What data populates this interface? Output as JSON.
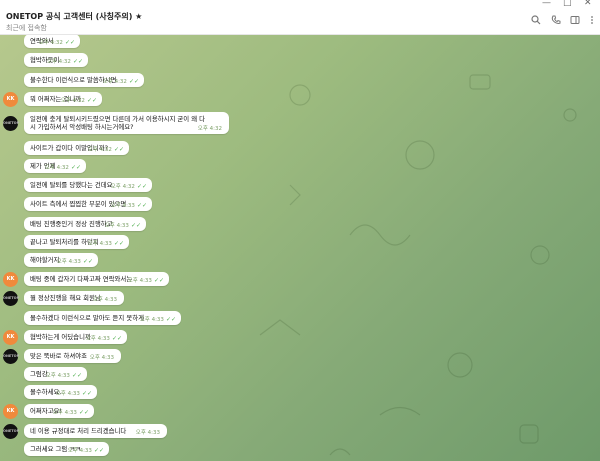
{
  "window": {
    "controls": [
      "—",
      "□",
      "✕"
    ]
  },
  "header": {
    "title": "ONETOP 공식 고객센터 (사칭주의) ★",
    "subtitle": "최근에 접속함",
    "icons": [
      "search-icon",
      "phone-icon",
      "sidebar-icon",
      "more-icon"
    ]
  },
  "messages": [
    {
      "text": "연락와서",
      "time": "오후 4:32",
      "read": "✓✓"
    },
    {
      "text": "협박하듯이",
      "time": "오후 4:32",
      "read": "✓✓"
    },
    {
      "text": "불수한다 이런식으로 말씀하시면",
      "time": "오후 4:32",
      "read": "✓✓"
    },
    {
      "text": "뭐 어쩌자는 겁니까",
      "time": "오후 4:32",
      "read": "✓✓",
      "avatar": "KK"
    },
    {
      "text": "일전에 충게 탈퇴시키드렸으면 다른데 가서 이용하시지 굳이 왜 다시 가입하셔서 악성배팅 하시는거에요?",
      "time": "오후 4:32",
      "read": "",
      "avatar": "ONETOP"
    },
    {
      "text": "사이트가 갑이다 이말입니까?",
      "time": "오후 4:32",
      "read": "✓✓"
    },
    {
      "text": "제가 언제",
      "time": "오후 4:32",
      "read": "✓✓"
    },
    {
      "text": "일전에 탈퇴를 당했다는 건데요",
      "time": "오후 4:32",
      "read": "✓✓"
    },
    {
      "text": "사이트 측에서 찝찝한 부분이 있으면",
      "time": "오후 4:33",
      "read": "✓✓"
    },
    {
      "text": "배팅 진행중인거 정상 진행하고",
      "time": "오후 4:33",
      "read": "✓✓"
    },
    {
      "text": "끝나고 탈퇴처리를 하던지",
      "time": "오후 4:33",
      "read": "✓✓"
    },
    {
      "text": "해야할거지",
      "time": "오후 4:33",
      "read": "✓✓"
    },
    {
      "text": "배팅 중에 갑자기 다짜고짜 연락와서는",
      "time": "오후 4:33",
      "read": "✓✓",
      "avatar": "KK"
    },
    {
      "text": "뭘 정상진행을 해요 회원님",
      "time": "오후 4:33",
      "read": "",
      "avatar": "ONETOP"
    },
    {
      "text": "몰수하겠다 이런식으로 말아도 듣지 못하게",
      "time": "오후 4:33",
      "read": "✓✓"
    },
    {
      "text": "협박하는게 어딨습니까",
      "time": "오후 4:33",
      "read": "✓✓",
      "avatar": "KK"
    },
    {
      "text": "맞은 뚝바로 하셔야죠",
      "time": "오후 4:33",
      "read": "",
      "avatar": "ONETOP"
    },
    {
      "text": "그럼강",
      "time": "오후 4:33",
      "read": "✓✓"
    },
    {
      "text": "몰수하세요.",
      "time": "오후 4:33",
      "read": "✓✓"
    },
    {
      "text": "어쩌자고요!",
      "time": "오후 4:33",
      "read": "✓✓",
      "avatar": "KK"
    },
    {
      "text": "네 이용 규정대로 처리 드리겠습니다",
      "time": "오후 4:33",
      "read": "",
      "avatar": "ONETOP"
    },
    {
      "text": "그러세요 그럼 ㅋㅋ",
      "time": "오후 4:33",
      "read": "✓✓"
    }
  ],
  "colors": {
    "avatar_kk": "#f08a3c",
    "avatar_onetop": "#111111",
    "read_tick": "#4fae4e"
  }
}
